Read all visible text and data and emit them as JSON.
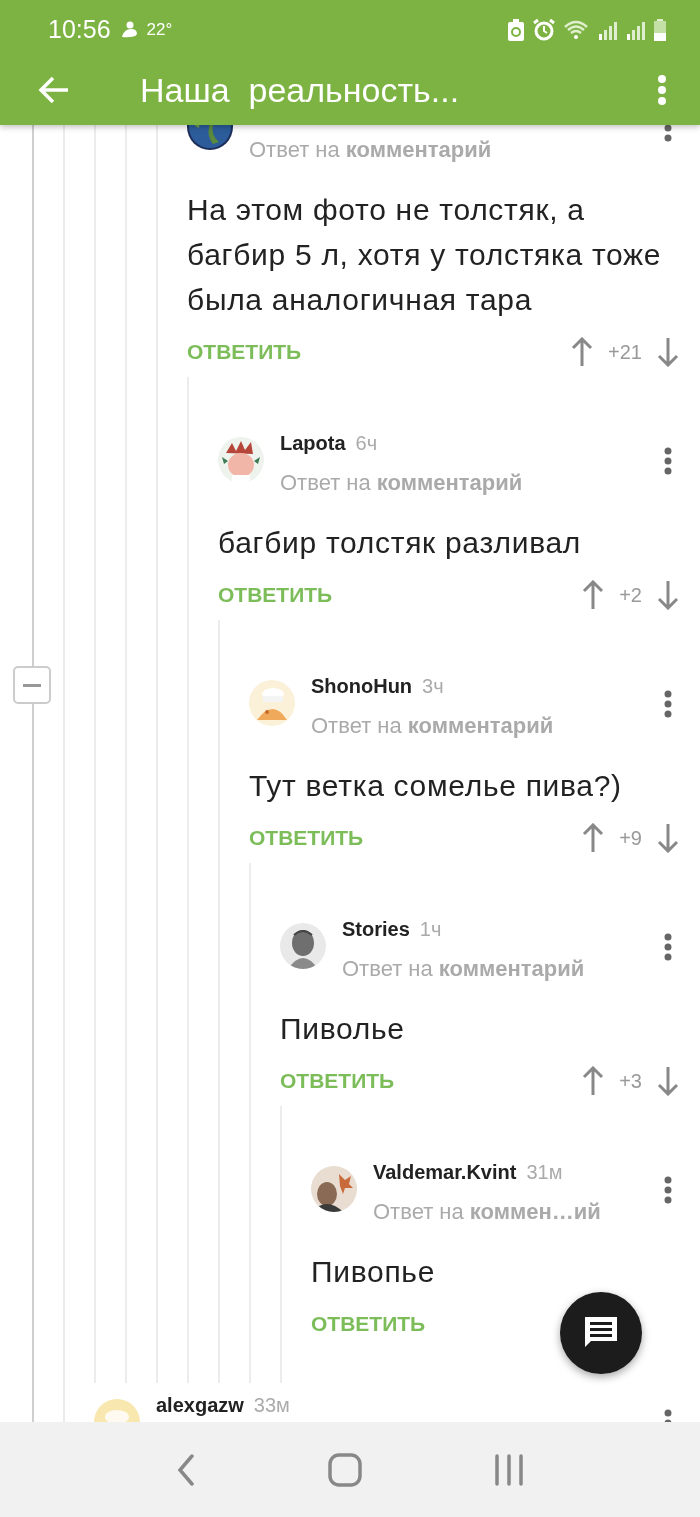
{
  "status_bar": {
    "time": "10:56",
    "temperature": "22°"
  },
  "toolbar": {
    "title": "Наша  реальность..."
  },
  "comments": [
    {
      "reply_to": "Ответ на **комментарий**",
      "text": "На этом фото не толстяк, а багбир 5 л, хотя у толстяка тоже была аналогичная тара",
      "reply_label": "ОТВЕТИТЬ",
      "score": "+21",
      "children": [
        {
          "author": "Lapota",
          "time": "6ч",
          "reply_to": "Ответ на **комментарий**",
          "text": "багбир толстяк разливал",
          "reply_label": "ОТВЕТИТЬ",
          "score": "+2",
          "children": [
            {
              "author": "ShonoHun",
              "time": "3ч",
              "reply_to": "Ответ на **комментарий**",
              "text": "Тут ветка сомелье пива?)",
              "reply_label": "ОТВЕТИТЬ",
              "score": "+9",
              "children": [
                {
                  "author": "Stories",
                  "time": "1ч",
                  "reply_to": "Ответ на **комментарий**",
                  "text": "Пиволье",
                  "reply_label": "ОТВЕТИТЬ",
                  "score": "+3",
                  "children": [
                    {
                      "author": "Valdemar.Kvint",
                      "time": "31м",
                      "reply_to": "Ответ на **коммен…ий**",
                      "text": "Пивопье",
                      "reply_label": "ОТВЕТИТЬ"
                    }
                  ]
                }
              ]
            }
          ]
        }
      ]
    }
  ],
  "next_comment": {
    "author": "alexgazw",
    "time": "33м"
  }
}
